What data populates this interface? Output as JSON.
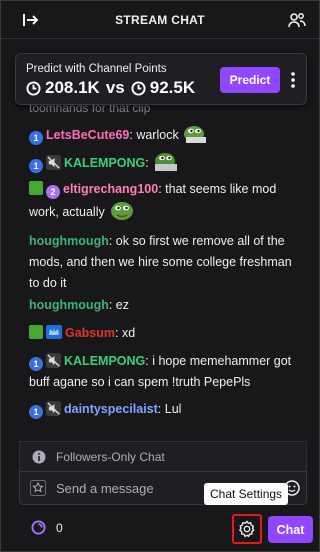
{
  "header": {
    "title": "STREAM CHAT",
    "left_icon": "collapse-arrow-icon",
    "right_icon": "users-icon"
  },
  "prediction": {
    "title": "Predict with Channel Points",
    "points_a": "208.1K",
    "vs": "vs",
    "points_b": "92.5K",
    "button_label": "Predict"
  },
  "cutoff_text": "toomhands for that clip",
  "messages": [
    {
      "badges": [
        "badge-1"
      ],
      "user": "LetsBeCute69",
      "color": "#ff6fb4",
      "sep": ": ",
      "text": "warlock",
      "emote": true
    },
    {
      "badges": [
        "badge-1",
        "badge-muted"
      ],
      "user": "KALEMPONG",
      "color": "#3cd07a",
      "sep": ": ",
      "text": "",
      "emote": true
    },
    {
      "badges": [
        "badge-sword",
        "badge-2"
      ],
      "user": "eltigrechang100",
      "color": "#ff7eb6",
      "sep": ": ",
      "text": "that seems like mod work, actually",
      "emote": true
    },
    {
      "badges": [],
      "user": "houghmough",
      "color": "#3cb371",
      "sep": ": ",
      "text": "ok so first we remove all of the mods, and then we hire some college freshman to do it",
      "emote": false
    },
    {
      "badges": [],
      "user": "houghmough",
      "color": "#3cb371",
      "sep": ": ",
      "text": "ez",
      "emote": false
    },
    {
      "badges": [
        "badge-sword",
        "badge-crown"
      ],
      "user": "Gabsum",
      "color": "#e5302a",
      "sep": ": ",
      "text": "xd",
      "emote": false
    },
    {
      "badges": [
        "badge-1",
        "badge-muted"
      ],
      "user": "KALEMPONG",
      "color": "#3cd07a",
      "sep": ": ",
      "text": "i hope memehammer got buff agane so i can spem !truth PepePls",
      "emote": false
    },
    {
      "badges": [
        "badge-1",
        "badge-muted"
      ],
      "user": "daintyspecilaist",
      "color": "#7aa9ff",
      "sep": ": ",
      "text": "Lul",
      "emote": false
    }
  ],
  "followers_only": "Followers-Only Chat",
  "input": {
    "placeholder": "Send a message"
  },
  "tooltip": "Chat Settings",
  "channel_points_count": "0",
  "chat_button": "Chat",
  "colors": {
    "accent": "#9147ff",
    "background": "#18181b",
    "highlight": "#e91916"
  }
}
